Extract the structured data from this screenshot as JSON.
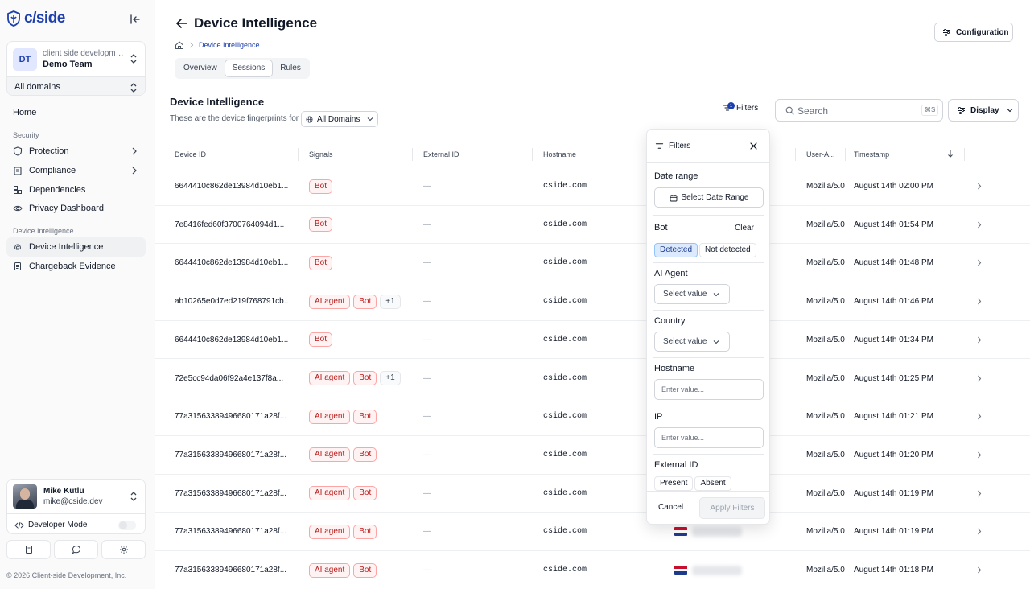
{
  "brand": {
    "logo_text": "c/side"
  },
  "team": {
    "initials": "DT",
    "org": "client side development ...",
    "name": "Demo Team",
    "domains_label": "All domains"
  },
  "nav": {
    "home": "Home",
    "security_section": "Security",
    "protection": "Protection",
    "compliance": "Compliance",
    "dependencies": "Dependencies",
    "privacy": "Privacy Dashboard",
    "device_section": "Device Intelligence",
    "device_intelligence": "Device Intelligence",
    "chargeback": "Chargeback Evidence"
  },
  "user": {
    "name": "Mike Kutlu",
    "email": "mike@cside.dev",
    "dev_mode_label": "Developer Mode",
    "dev_mode": false
  },
  "footer": {
    "copyright": "© 2026 Client-side Development, Inc."
  },
  "header": {
    "title": "Device Intelligence",
    "breadcrumb_current": "Device Intelligence",
    "tabs": [
      "Overview",
      "Sessions",
      "Rules"
    ],
    "active_tab": "Sessions",
    "config_label": "Configuration"
  },
  "section": {
    "title": "Device Intelligence",
    "subtitle": "These are the device fingerprints for",
    "domain_select": "All Domains"
  },
  "toolbar": {
    "filters_label": "Filters",
    "filters_count": "1",
    "search_placeholder": "Search",
    "search_shortcut": "⌘S",
    "display_label": "Display"
  },
  "table": {
    "columns": {
      "device_id": "Device ID",
      "signals": "Signals",
      "external_id": "External ID",
      "hostname": "Hostname",
      "user_agent": "User-A...",
      "timestamp": "Timestamp"
    },
    "rows": [
      {
        "device_id": "6644410c862de13984d10eb1...",
        "signals": [
          "Bot"
        ],
        "external_id": "—",
        "hostname": "cside.com",
        "country": "",
        "user_agent": "Mozilla/5.0",
        "timestamp": "August 14th 02:00 PM"
      },
      {
        "device_id": "7e8416fed60f3700764094d1...",
        "signals": [
          "Bot"
        ],
        "external_id": "—",
        "hostname": "cside.com",
        "country": "",
        "user_agent": "Mozilla/5.0",
        "timestamp": "August 14th 01:54 PM"
      },
      {
        "device_id": "6644410c862de13984d10eb1...",
        "signals": [
          "Bot"
        ],
        "external_id": "—",
        "hostname": "cside.com",
        "country": "",
        "user_agent": "Mozilla/5.0",
        "timestamp": "August 14th 01:48 PM"
      },
      {
        "device_id": "ab10265e0d7ed219f768791cb...",
        "signals": [
          "AI agent",
          "Bot",
          "+1"
        ],
        "external_id": "—",
        "hostname": "cside.com",
        "country": "",
        "user_agent": "Mozilla/5.0",
        "timestamp": "August 14th 01:46 PM"
      },
      {
        "device_id": "6644410c862de13984d10eb1...",
        "signals": [
          "Bot"
        ],
        "external_id": "—",
        "hostname": "cside.com",
        "country": "",
        "user_agent": "Mozilla/5.0",
        "timestamp": "August 14th 01:34 PM"
      },
      {
        "device_id": "72e5cc94da06f92a4e137f8a...",
        "signals": [
          "AI agent",
          "Bot",
          "+1"
        ],
        "external_id": "—",
        "hostname": "cside.com",
        "country": "",
        "user_agent": "Mozilla/5.0",
        "timestamp": "August 14th 01:25 PM"
      },
      {
        "device_id": "77a31563389496680171a28f...",
        "signals": [
          "AI agent",
          "Bot"
        ],
        "external_id": "—",
        "hostname": "cside.com",
        "country": "",
        "user_agent": "Mozilla/5.0",
        "timestamp": "August 14th 01:21 PM"
      },
      {
        "device_id": "77a31563389496680171a28f...",
        "signals": [
          "AI agent",
          "Bot"
        ],
        "external_id": "—",
        "hostname": "cside.com",
        "country": "",
        "user_agent": "Mozilla/5.0",
        "timestamp": "August 14th 01:20 PM"
      },
      {
        "device_id": "77a31563389496680171a28f...",
        "signals": [
          "AI agent",
          "Bot"
        ],
        "external_id": "—",
        "hostname": "cside.com",
        "country": "",
        "user_agent": "Mozilla/5.0",
        "timestamp": "August 14th 01:19 PM"
      },
      {
        "device_id": "77a31563389496680171a28f...",
        "signals": [
          "AI agent",
          "Bot"
        ],
        "external_id": "—",
        "hostname": "cside.com",
        "country": "NL",
        "user_agent": "Mozilla/5.0",
        "timestamp": "August 14th 01:19 PM"
      },
      {
        "device_id": "77a31563389496680171a28f...",
        "signals": [
          "AI agent",
          "Bot"
        ],
        "external_id": "—",
        "hostname": "cside.com",
        "country": "NL",
        "user_agent": "Mozilla/5.0",
        "timestamp": "August 14th 01:18 PM"
      }
    ]
  },
  "filters_panel": {
    "title": "Filters",
    "date_range_label": "Date range",
    "date_range_button": "Select Date Range",
    "bot_label": "Bot",
    "clear_label": "Clear",
    "bot_options": [
      "Detected",
      "Not detected"
    ],
    "bot_selected": "Detected",
    "ai_agent_label": "AI Agent",
    "ai_agent_value": "Select value",
    "country_label": "Country",
    "country_value": "Select value",
    "hostname_label": "Hostname",
    "hostname_placeholder": "Enter value...",
    "ip_label": "IP",
    "ip_placeholder": "Enter value...",
    "external_id_label": "External ID",
    "external_id_options": [
      "Present",
      "Absent"
    ],
    "cancel_label": "Cancel",
    "apply_label": "Apply Filters"
  },
  "colors": {
    "accent": "#1e40af",
    "badge_border": "#fca5a5",
    "badge_bg": "#fef2f2",
    "badge_text": "#b91c1c",
    "selected_bg": "#dbeafe"
  }
}
